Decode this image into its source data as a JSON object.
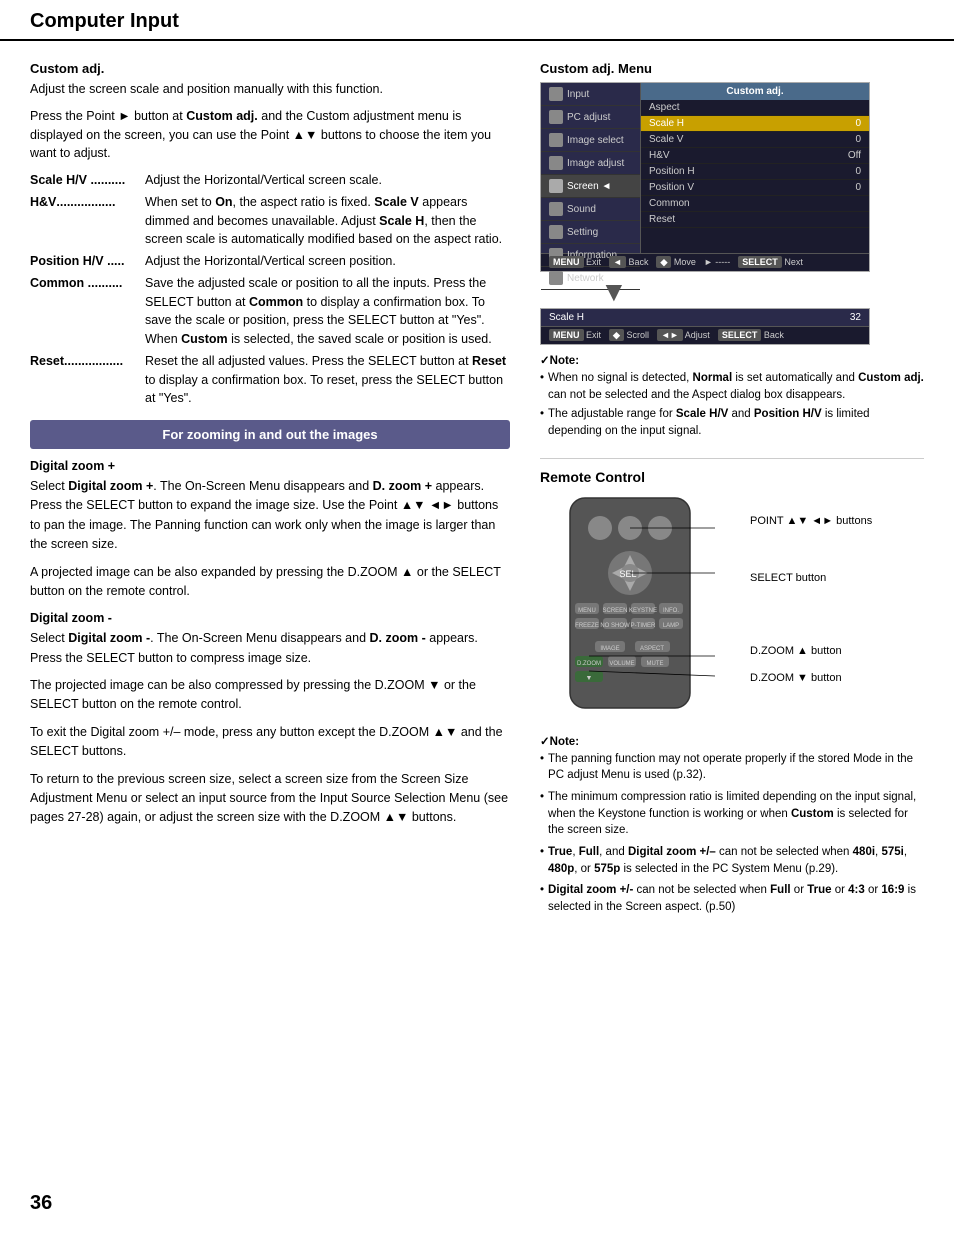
{
  "header": {
    "title": "Computer Input"
  },
  "page_number": "36",
  "left": {
    "custom_adj": {
      "title": "Custom adj.",
      "body1": "Adjust the screen scale and position manually with this function.",
      "body2": "Press the Point ► button at Custom adj. and the Custom adjustment menu is displayed on the screen, you can use the Point ▲▼ buttons to choose the item you want to adjust.",
      "items": [
        {
          "key": "Scale H/V ..........",
          "value": "Adjust the Horizontal/Vertical screen scale."
        },
        {
          "key": "H&V.................",
          "value": "When set to On, the aspect ratio is fixed. Scale V appears dimmed and becomes unavailable. Adjust Scale H, then the screen scale is automatically modified based on the aspect ratio."
        },
        {
          "key": "Position H/V .....",
          "value": "Adjust the Horizontal/Vertical screen position."
        },
        {
          "key": "Common ..........",
          "value": "Save the adjusted scale or position to all the inputs. Press the SELECT button at Common to display a confirmation box. To save the scale or position, press the SELECT button at \"Yes\". When Custom is selected, the saved scale or position is used."
        },
        {
          "key": "Reset.................",
          "value": "Reset the all adjusted values. Press the SELECT button at Reset to display a confirmation box. To reset, press the SELECT button at \"Yes\"."
        }
      ]
    },
    "banner": "For zooming in and out the images",
    "digital_zoom_plus": {
      "title": "Digital zoom +",
      "body1": "Select Digital zoom +. The On-Screen Menu disappears and D. zoom + appears. Press the SELECT button to expand the image size. Use the Point ▲▼ ◄► buttons to pan the image. The Panning function can work only when the image is larger than the screen size.",
      "body2": "A projected image can be also expanded by pressing the D.ZOOM ▲ or the SELECT button on the remote control."
    },
    "digital_zoom_minus": {
      "title": "Digital zoom -",
      "body1": "Select Digital zoom -. The On-Screen Menu disappears and D. zoom - appears. Press the SELECT button to compress image size.",
      "body2": "The projected image can be also compressed by pressing the D.ZOOM ▼ or the SELECT button on the remote control."
    },
    "exit_note": "To exit the Digital zoom +/– mode, press any button except the D.ZOOM ▲▼ and the SELECT buttons.",
    "return_note": "To return to the previous screen size, select a screen size from the Screen Size Adjustment Menu or select an input source from the Input Source Selection Menu (see pages 27-28) again, or adjust the screen size with the D.ZOOM ▲▼ buttons."
  },
  "right": {
    "custom_adj_menu": {
      "title": "Custom adj. Menu",
      "menu_items_left": [
        {
          "label": "Input",
          "active": false
        },
        {
          "label": "PC adjust",
          "active": false
        },
        {
          "label": "Image select",
          "active": false
        },
        {
          "label": "Image adjust",
          "active": false
        },
        {
          "label": "Screen",
          "active": true
        },
        {
          "label": "Sound",
          "active": false
        },
        {
          "label": "Setting",
          "active": false
        },
        {
          "label": "Information",
          "active": false
        },
        {
          "label": "Network",
          "active": false
        }
      ],
      "menu_header": "Custom adj.",
      "menu_items_right": [
        {
          "label": "Aspect",
          "value": "",
          "selected": false
        },
        {
          "label": "Scale H",
          "value": "0",
          "selected": true
        },
        {
          "label": "Scale V",
          "value": "0",
          "selected": false
        },
        {
          "label": "H&V",
          "value": "Off",
          "selected": false
        },
        {
          "label": "Position H",
          "value": "0",
          "selected": false
        },
        {
          "label": "Position V",
          "value": "0",
          "selected": false
        },
        {
          "label": "Common",
          "value": "",
          "selected": false
        },
        {
          "label": "Reset",
          "value": "",
          "selected": false
        }
      ],
      "footer_items": [
        "MENU Exit",
        "◄ Back",
        "◆ Move",
        "► -----",
        "SELECT Next"
      ]
    },
    "scale_bar": {
      "label": "Scale H",
      "value": "32",
      "footer_items": [
        "MENU Exit",
        "◆ Scroll",
        "◄► Adjust",
        "SELECT Back"
      ]
    },
    "notes": [
      "When no signal is detected, Normal is set automatically and Custom adj. can not be selected and the Aspect dialog box disappears.",
      "The adjustable range for Scale H/V and Position H/V is limited depending on the input signal."
    ],
    "remote_control": {
      "title": "Remote Control",
      "labels": [
        "POINT ▲▼ ◄► buttons",
        "SELECT button",
        "D.ZOOM ▲ button",
        "D.ZOOM ▼ button"
      ]
    },
    "remote_notes": [
      "The panning function may not operate properly if the stored Mode in the PC adjust Menu is used (p.32).",
      "The minimum compression ratio is limited depending on the input signal, when the Keystone function is working or when Custom is selected for the screen size.",
      "True, Full, and Digital zoom +/– can not be selected when 480i, 575i, 480p, or 575p is selected in the PC System Menu (p.29).",
      "Digital zoom +/- can not be selected when Full or True or 4:3 or 16:9  is selected in the Screen aspect. (p.50)"
    ]
  }
}
